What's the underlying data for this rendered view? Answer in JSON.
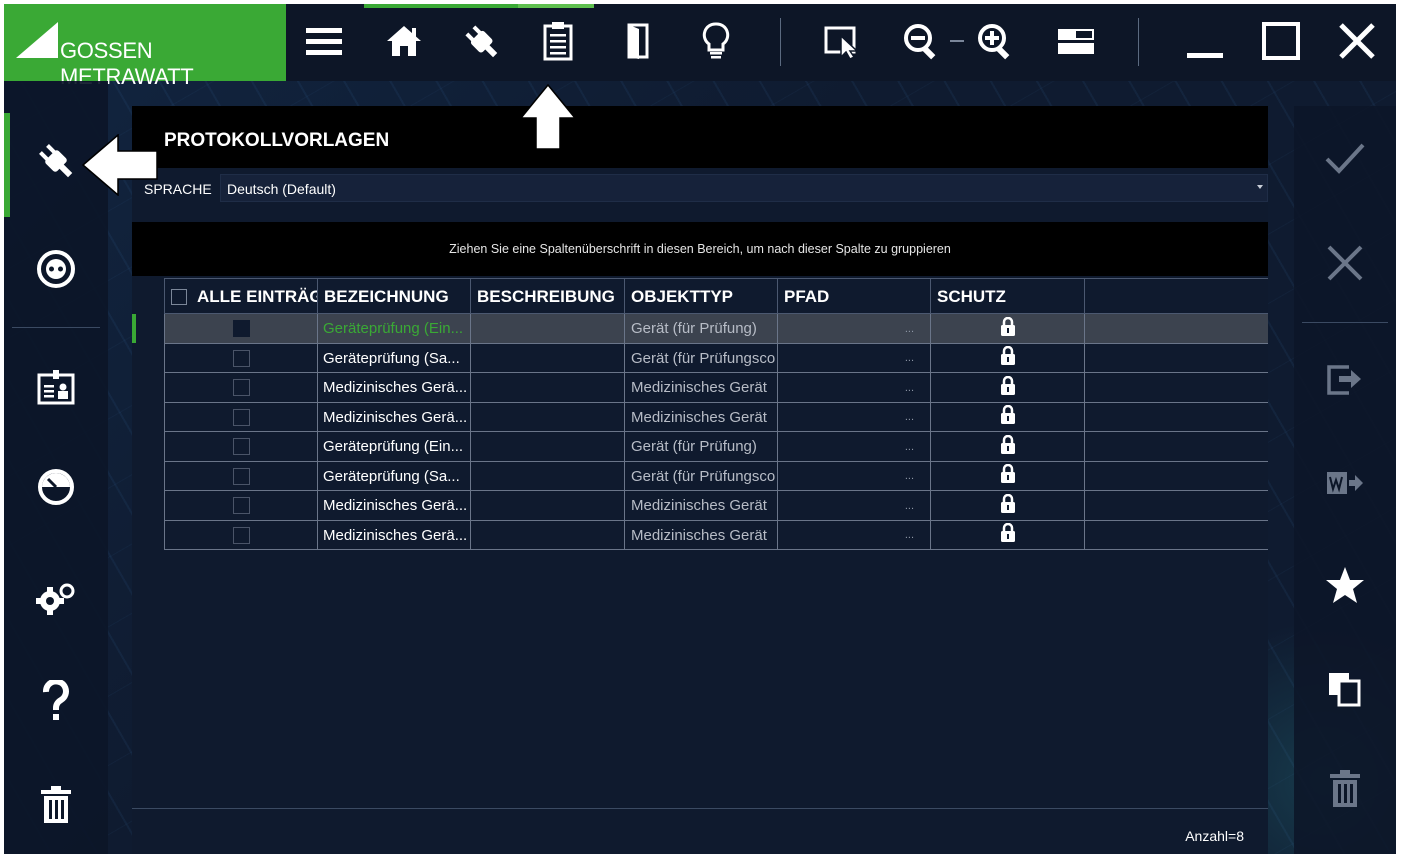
{
  "brand": {
    "name": "GOSSEN METRAWATT"
  },
  "toolbar": {
    "icons": [
      "menu-icon",
      "home-icon",
      "plug-icon",
      "clipboard-icon",
      "door-icon",
      "lightbulb-icon",
      "select-cursor-icon",
      "zoom-out-icon",
      "zoom-in-icon",
      "layout-icon",
      "minimize-icon",
      "maximize-icon",
      "close-icon"
    ]
  },
  "left_nav": {
    "icons": [
      "plug-icon",
      "socket-icon",
      "id-card-icon",
      "gauge-icon",
      "settings-icon",
      "help-icon",
      "trash-icon"
    ]
  },
  "right_nav": {
    "icons": [
      "check-icon",
      "cancel-icon",
      "export-icon",
      "word-export-icon",
      "star-icon",
      "copy-icon",
      "trash-icon"
    ]
  },
  "panel": {
    "title": "PROTOKOLLVORLAGEN",
    "language_label": "SPRACHE",
    "language_value": "Deutsch (Default)",
    "group_hint": "Ziehen Sie eine Spaltenüberschrift in diesen Bereich, um nach dieser Spalte zu gruppieren"
  },
  "table": {
    "columns": [
      "ALLE EINTRÄGE",
      "BEZEICHNUNG",
      "BESCHREIBUNG",
      "OBJEKTTYP",
      "PFAD",
      "SCHUTZ"
    ],
    "rows": [
      {
        "name": "Geräteprüfung (Ein...",
        "description": "",
        "type": "Gerät (für Prüfung)",
        "path": "...",
        "selected": true
      },
      {
        "name": "Geräteprüfung (Sa...",
        "description": "",
        "type": "Gerät (für Prüfungsco",
        "path": "...",
        "selected": false
      },
      {
        "name": "Medizinisches Gerä...",
        "description": "",
        "type": "Medizinisches Gerät",
        "path": "...",
        "selected": false
      },
      {
        "name": "Medizinisches Gerä...",
        "description": "",
        "type": "Medizinisches Gerät",
        "path": "...",
        "selected": false
      },
      {
        "name": "Geräteprüfung (Ein...",
        "description": "",
        "type": "Gerät (für Prüfung)",
        "path": "...",
        "selected": false
      },
      {
        "name": "Geräteprüfung (Sa...",
        "description": "",
        "type": "Gerät (für Prüfungsco",
        "path": "...",
        "selected": false
      },
      {
        "name": "Medizinisches Gerä...",
        "description": "",
        "type": "Medizinisches Gerät",
        "path": "...",
        "selected": false
      },
      {
        "name": "Medizinisches Gerä...",
        "description": "",
        "type": "Medizinisches Gerät",
        "path": "...",
        "selected": false
      }
    ],
    "count_label": "Anzahl=8"
  },
  "colors": {
    "accent": "#3aa935",
    "background": "#0f1a2e",
    "header": "#000000"
  }
}
